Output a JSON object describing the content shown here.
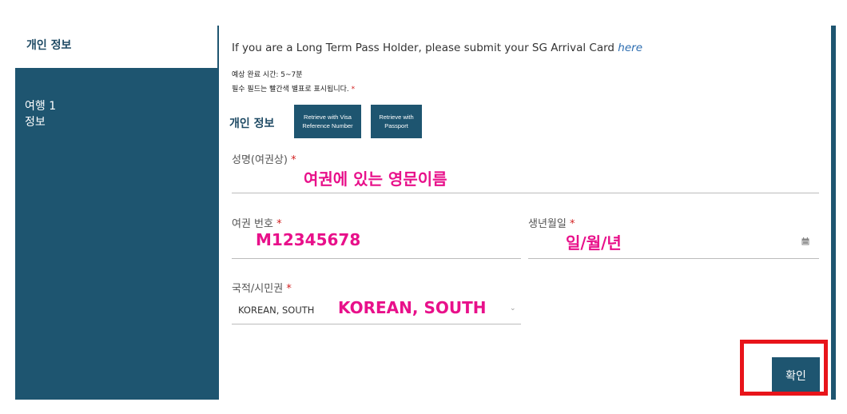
{
  "sidebar": {
    "active_item": "개인 정보",
    "trip_item": "여행 1\n정보"
  },
  "notice": {
    "text": "If you are a Long Term Pass Holder, please submit your SG Arrival Card ",
    "link": "here"
  },
  "info": {
    "completion_time": "예상 완료 시간: 5~7분",
    "required_note": "필수 필드는 빨간색 별표로 표시됩니다.",
    "required_mark": "*"
  },
  "personal": {
    "title": "개인 정보",
    "btn_visa": "Retrieve with Visa Reference Number",
    "btn_passport": "Retrieve with Passport"
  },
  "fields": {
    "name_label": "성명(여권상)",
    "name_hint": "여권에 있는 영문이름",
    "passport_label": "여권 번호",
    "passport_hint": "M12345678",
    "dob_label": "생년월일",
    "dob_hint": "일/월/년",
    "nationality_label": "국적/시민권",
    "nationality_value": "KOREAN, SOUTH",
    "nationality_hint": "KOREAN, SOUTH"
  },
  "confirm_label": "확인",
  "colors": {
    "primary": "#1e5570",
    "annotation": "#e8108a",
    "highlight_box": "#e8141a",
    "required": "#d21f1f"
  },
  "icons": [
    "calendar-icon",
    "caret-down-icon"
  ]
}
